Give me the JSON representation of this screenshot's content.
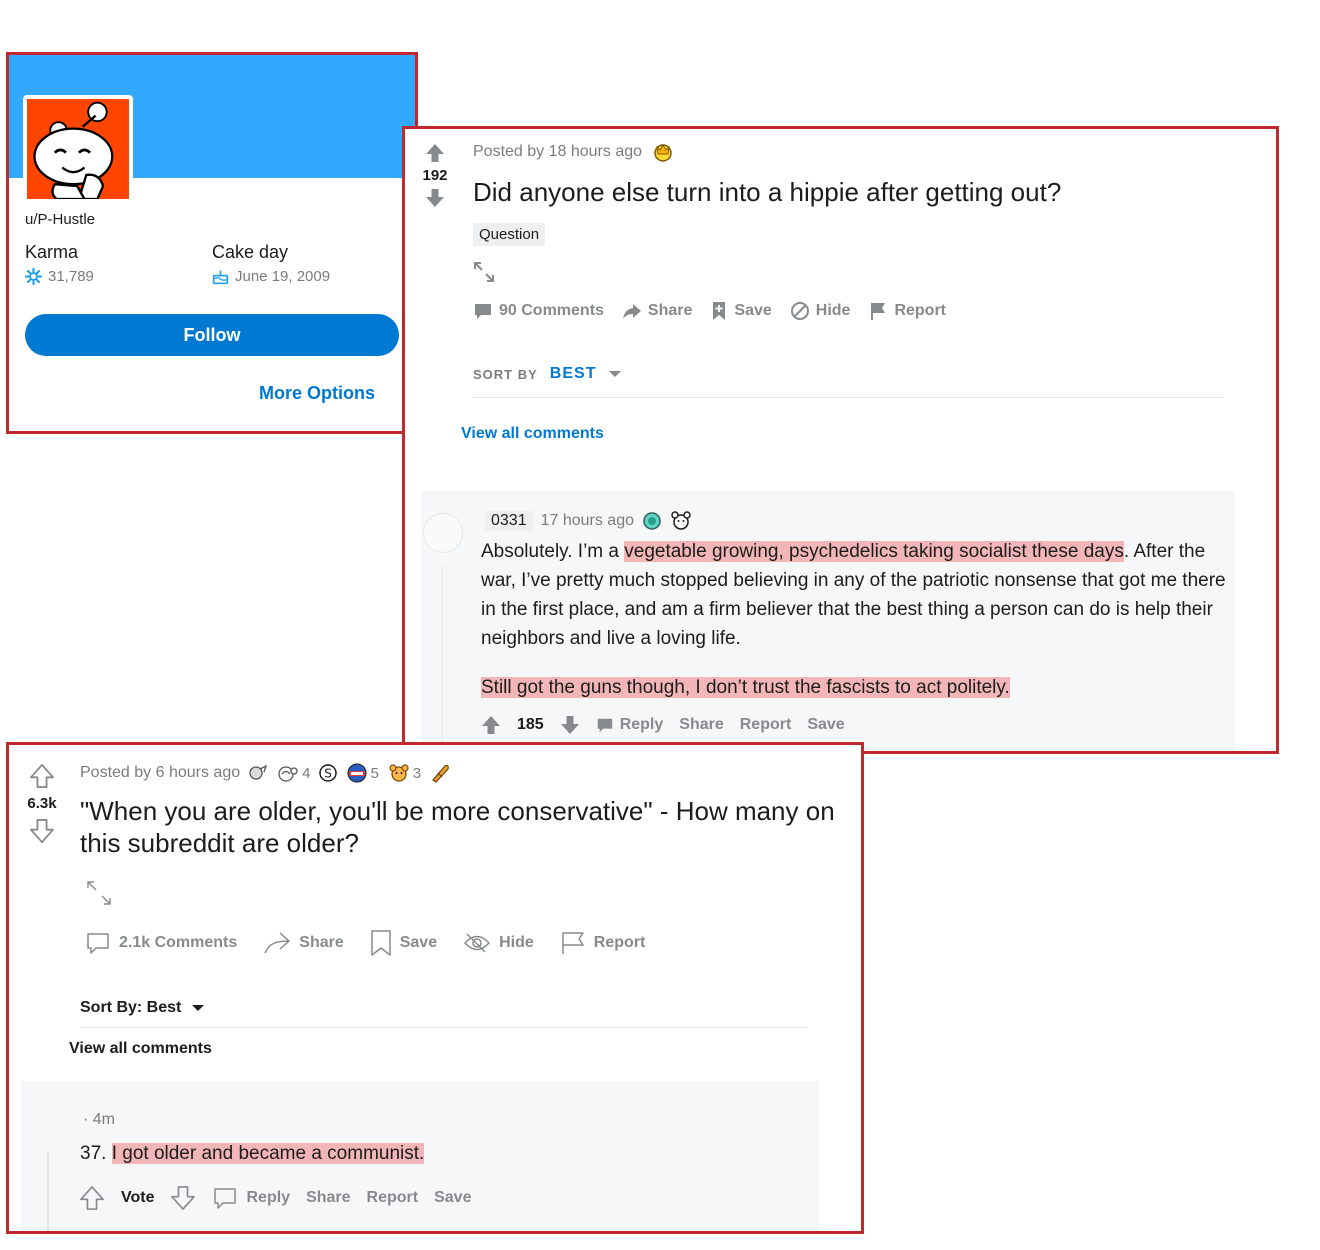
{
  "profile": {
    "username": "u/P-Hustle",
    "karma_label": "Karma",
    "karma_value": "31,789",
    "cake_label": "Cake day",
    "cake_value": "June 19, 2009",
    "follow_label": "Follow",
    "more_options_label": "More Options",
    "colors": {
      "banner": "#33a8ff",
      "avatar_bg": "#ff4500",
      "button": "#0079d3"
    }
  },
  "post1": {
    "score": "192",
    "meta": "Posted by 18 hours ago",
    "title": "Did anyone else turn into a hippie after getting out?",
    "flair": "Question",
    "actions": {
      "comments": "90 Comments",
      "share": "Share",
      "save": "Save",
      "hide": "Hide",
      "report": "Report"
    },
    "sort_label": "SORT BY",
    "sort_value": "BEST",
    "view_all": "View all comments",
    "comment": {
      "user": "0331",
      "time": "17 hours ago",
      "body_pre": "Absolutely. I’m a ",
      "body_hl": "vegetable growing, psychedelics taking socialist these days",
      "body_post": ". After the war, I’ve pretty much stopped believing in any of the patriotic nonsense that got me there in the first place, and am a firm believer that the best thing a person can do is help their neighbors and live a loving life.",
      "body2": "Still got the guns though, I don’t trust the fascists to act politely.",
      "score": "185",
      "reply": "Reply",
      "share": "Share",
      "report": "Report",
      "save": "Save"
    }
  },
  "post2": {
    "score": "6.3k",
    "meta": "Posted by 6 hours ago",
    "awards": [
      "4",
      "5",
      "3"
    ],
    "title": "\"When you are older, you'll be more conservative\" - How many on this subreddit are older?",
    "actions": {
      "comments": "2.1k Comments",
      "share": "Share",
      "save": "Save",
      "hide": "Hide",
      "report": "Report"
    },
    "sort": "Sort By: Best",
    "view_all": "View all comments",
    "comment": {
      "time": "· 4m",
      "prefix": "37.",
      "body_hl": "I got older and became a communist.",
      "vote": "Vote",
      "reply": "Reply",
      "share": "Share",
      "report": "Report",
      "save": "Save"
    }
  },
  "colors": {
    "highlight": "#f2b6b8",
    "frame": "#c0292d",
    "link_blue": "#0079d3"
  }
}
